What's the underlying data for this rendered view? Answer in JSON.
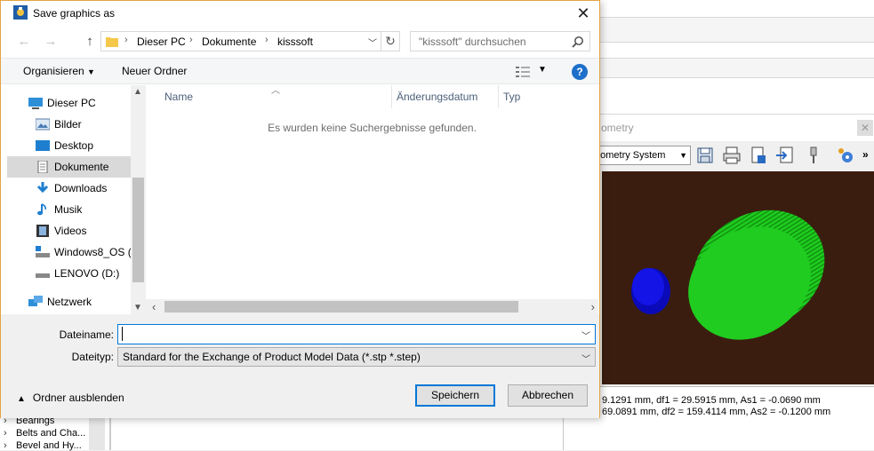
{
  "dialog": {
    "title": "Save graphics as",
    "breadcrumbs": [
      "Dieser PC",
      "Dokumente",
      "kisssoft"
    ],
    "search_placeholder": "\"kisssoft\" durchsuchen",
    "command_bar": {
      "organize": "Organisieren",
      "new_folder": "Neuer Ordner",
      "help": "?"
    },
    "nav_pane": {
      "items": [
        {
          "label": "Dieser PC",
          "icon": "computer-icon"
        },
        {
          "label": "Bilder",
          "icon": "pictures-icon"
        },
        {
          "label": "Desktop",
          "icon": "desktop-icon"
        },
        {
          "label": "Dokumente",
          "icon": "documents-icon",
          "selected": true
        },
        {
          "label": "Downloads",
          "icon": "downloads-icon"
        },
        {
          "label": "Musik",
          "icon": "music-icon"
        },
        {
          "label": "Videos",
          "icon": "videos-icon"
        },
        {
          "label": "Windows8_OS (C",
          "icon": "drive-icon"
        },
        {
          "label": "LENOVO (D:)",
          "icon": "drive-icon"
        },
        {
          "label": "Netzwerk",
          "icon": "network-icon"
        }
      ]
    },
    "file_list": {
      "columns": [
        "Name",
        "Änderungsdatum",
        "Typ"
      ],
      "empty_message": "Es wurden keine Suchergebnisse gefunden."
    },
    "filename_label": "Dateiname:",
    "filename_value": "",
    "filetype_label": "Dateityp:",
    "filetype_value": "Standard for the Exchange of Product Model Data (*.stp *.step)",
    "hide_folders": "Ordner ausblenden",
    "save_button": "Speichern",
    "cancel_button": "Abbrechen"
  },
  "background": {
    "viewer_title": "ometry",
    "coordinate_system": "eometry System",
    "output_lines": [
      "9.1291 mm, df1 = 29.5915 mm, As1 = -0.0690 mm",
      "69.0891 mm, df2 = 159.4114 mm, As2 = -0.1200 mm"
    ],
    "tree_items": [
      "Bearings",
      "Belts and Cha...",
      "Bevel and Hy..."
    ],
    "colors": {
      "canvas_bg": "#3b1d0f",
      "gear_large": "#1fcc1f",
      "gear_small": "#1010dd"
    }
  }
}
